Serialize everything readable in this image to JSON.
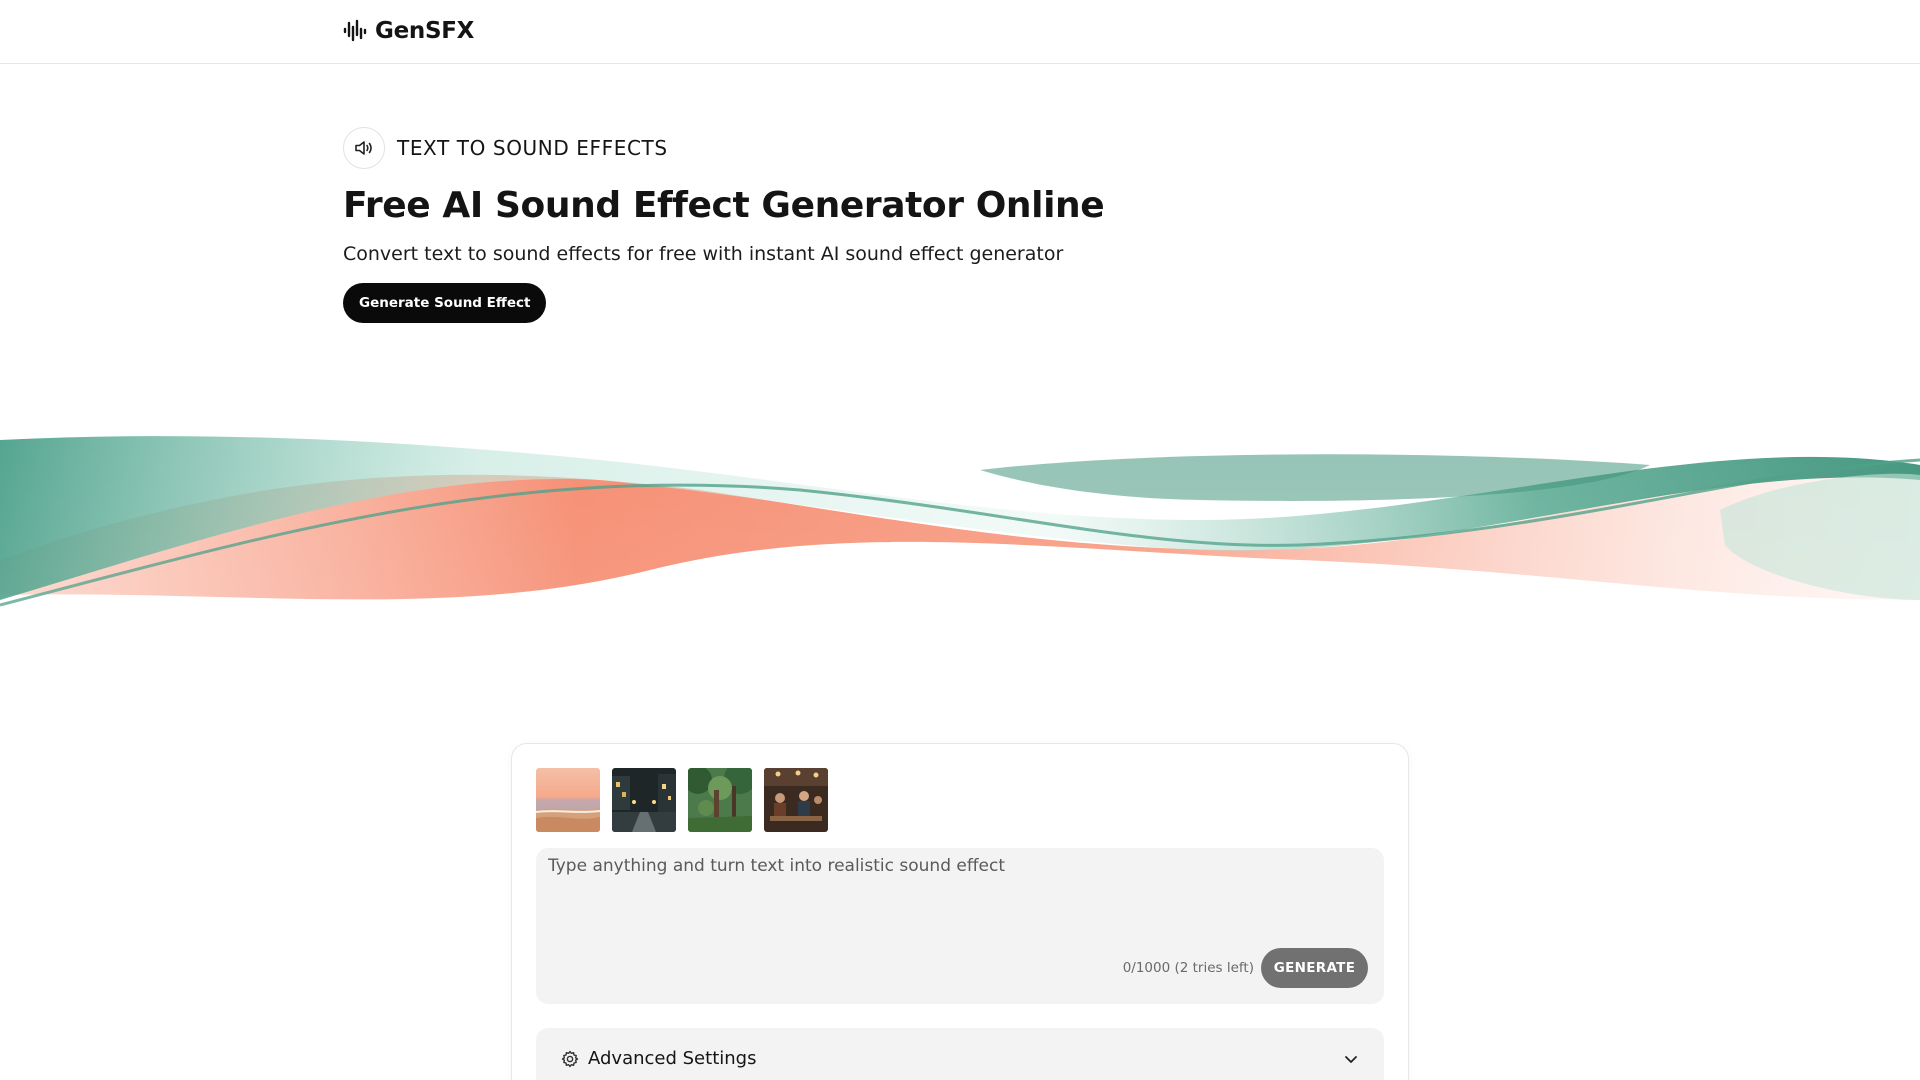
{
  "header": {
    "brand_name": "GenSFX",
    "brand_icon": "waveform-icon"
  },
  "hero": {
    "eyebrow_icon": "speaker-icon",
    "eyebrow": "TEXT TO SOUND EFFECTS",
    "title": "Free AI Sound Effect Generator Online",
    "subtitle": "Convert text to sound effects for free with instant AI sound effect generator",
    "cta_label": "Generate Sound Effect"
  },
  "generator": {
    "presets": [
      {
        "scene": "beach-sunset"
      },
      {
        "scene": "rainy-city-street"
      },
      {
        "scene": "forest"
      },
      {
        "scene": "cafe-crowd"
      }
    ],
    "prompt_placeholder": "Type anything and turn text into realistic sound effect",
    "prompt_value": "",
    "counter": "0/1000 (2 tries left)",
    "generate_label": "GENERATE",
    "advanced_label": "Advanced Settings",
    "advanced_icon": "gear-icon",
    "advanced_chevron": "chevron-down-icon"
  },
  "colors": {
    "accent_dark": "#0a0a0a",
    "wave_teal": "#3f9a82",
    "wave_coral": "#f5876a",
    "generate_disabled": "#717171",
    "panel_bg": "#f3f3f3"
  }
}
